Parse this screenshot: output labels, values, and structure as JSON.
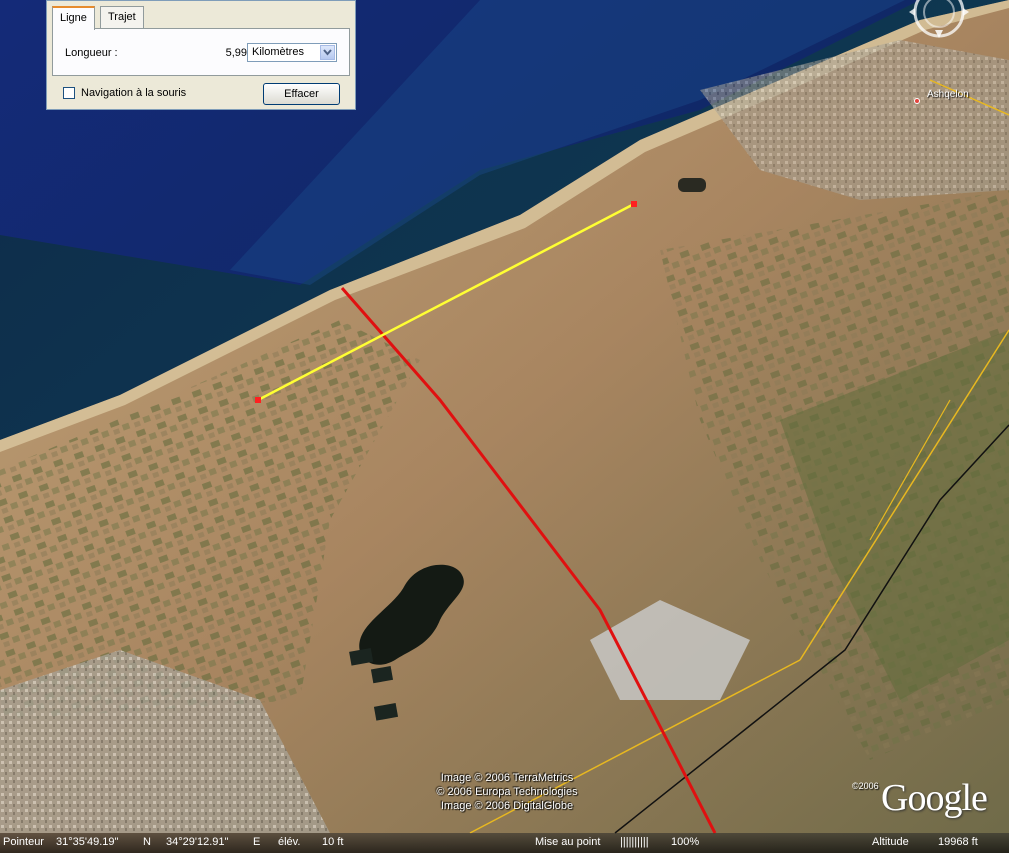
{
  "panel": {
    "tabs": [
      {
        "label": "Ligne",
        "active": true
      },
      {
        "label": "Trajet",
        "active": false
      }
    ],
    "length_label": "Longueur :",
    "length_value": "5,99",
    "unit": "Kilomètres",
    "mouse_nav_label": "Navigation à la souris",
    "mouse_nav_checked": false,
    "clear_button": "Effacer"
  },
  "map": {
    "place_label": "Ashqelon",
    "credits": [
      "Image © 2006 TerraMetrics",
      "© 2006 Europa Technologies",
      "Image © 2006 DigitalGlobe"
    ],
    "logo_copyright": "©2006",
    "logo": "Google",
    "colors": {
      "measure_line": "#ffff33",
      "border_line": "#e01010",
      "road_line": "#e8b820",
      "black_line": "#111111",
      "sea": "#0f2a5c",
      "land": "#b8966a"
    }
  },
  "status": {
    "pointer_label": "Pointeur",
    "latitude": "31°35'49.19\"",
    "lat_hemi": "N",
    "longitude": "34°29'12.91\"",
    "lon_hemi": "E",
    "elevation_label": "élév.",
    "elevation": "10 ft",
    "focus_label": "Mise au point",
    "focus_value": "||||||||||",
    "focus_percent": "100%",
    "altitude_label": "Altitude",
    "altitude": "19968 ft"
  }
}
